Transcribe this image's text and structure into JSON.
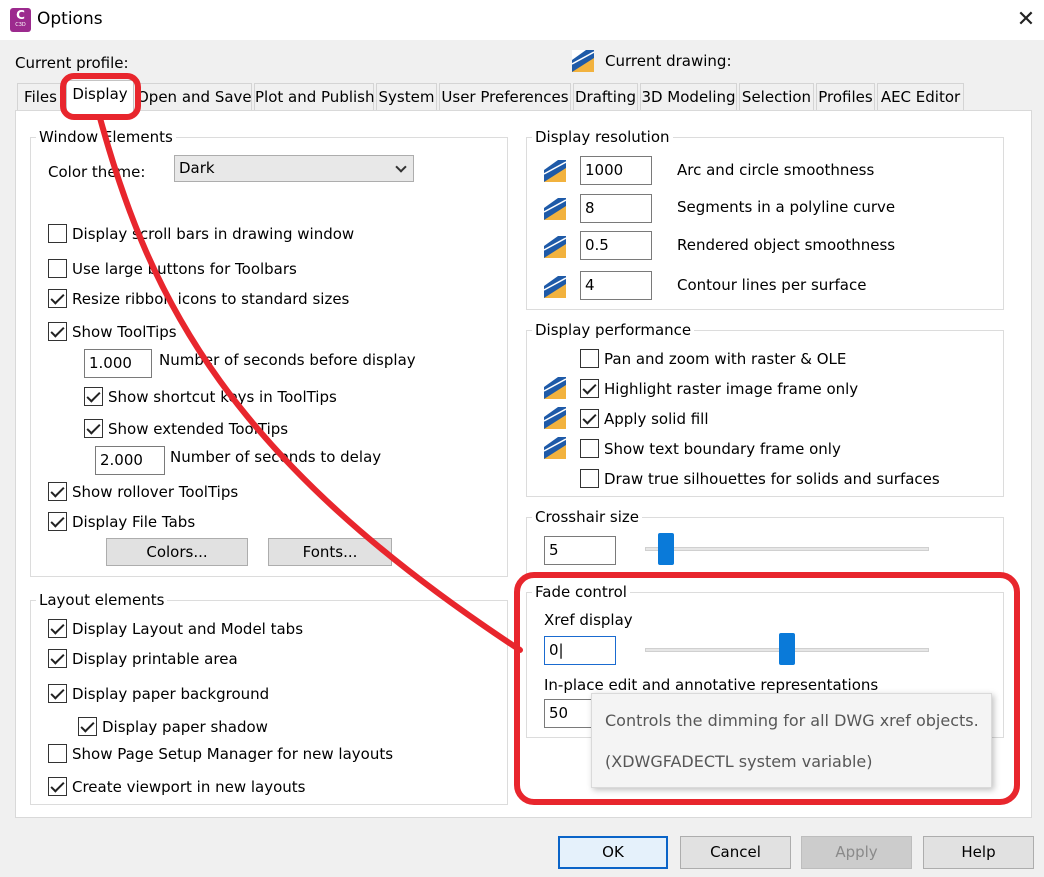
{
  "window": {
    "title": "Options",
    "app_icon_letter": "C",
    "app_icon_sub": "C3D"
  },
  "header": {
    "current_profile_label": "Current profile:",
    "current_drawing_label": "Current drawing:"
  },
  "tabs": [
    {
      "label": "Files"
    },
    {
      "label": "Display",
      "active": true
    },
    {
      "label": "Open and Save"
    },
    {
      "label": "Plot and Publish"
    },
    {
      "label": "System"
    },
    {
      "label": "User Preferences"
    },
    {
      "label": "Drafting"
    },
    {
      "label": "3D Modeling"
    },
    {
      "label": "Selection"
    },
    {
      "label": "Profiles"
    },
    {
      "label": "AEC Editor"
    }
  ],
  "window_elements": {
    "title": "Window Elements",
    "color_theme_label": "Color theme:",
    "color_theme_value": "Dark",
    "scroll_bars": {
      "label": "Display scroll bars in drawing window",
      "checked": false
    },
    "large_buttons": {
      "label": "Use large buttons for Toolbars",
      "checked": false
    },
    "resize_ribbon": {
      "label": "Resize ribbon icons to standard sizes",
      "checked": true
    },
    "show_tooltips": {
      "label": "Show ToolTips",
      "checked": true
    },
    "seconds_before": {
      "value": "1.000",
      "label": "Number of seconds before display"
    },
    "shortcut_keys": {
      "label": "Show shortcut keys in ToolTips",
      "checked": true
    },
    "extended_tooltips": {
      "label": "Show extended ToolTips",
      "checked": true
    },
    "seconds_delay": {
      "value": "2.000",
      "label": "Number of seconds to delay"
    },
    "rollover_tooltips": {
      "label": "Show rollover ToolTips",
      "checked": true
    },
    "file_tabs": {
      "label": "Display File Tabs",
      "checked": true
    },
    "colors_button": "Colors...",
    "fonts_button": "Fonts..."
  },
  "layout_elements": {
    "title": "Layout elements",
    "layout_model_tabs": {
      "label": "Display Layout and Model tabs",
      "checked": true
    },
    "printable_area": {
      "label": "Display printable area",
      "checked": true
    },
    "paper_background": {
      "label": "Display paper background",
      "checked": true
    },
    "paper_shadow": {
      "label": "Display paper shadow",
      "checked": true
    },
    "page_setup": {
      "label": "Show Page Setup Manager for new layouts",
      "checked": false
    },
    "create_viewport": {
      "label": "Create viewport in new layouts",
      "checked": true
    }
  },
  "display_resolution": {
    "title": "Display resolution",
    "arc_smoothness": {
      "value": "1000",
      "label": "Arc and circle smoothness"
    },
    "polyline_segments": {
      "value": "8",
      "label": "Segments in a polyline curve"
    },
    "rendered_smoothness": {
      "value": "0.5",
      "label": "Rendered object smoothness"
    },
    "contour_lines": {
      "value": "4",
      "label": "Contour lines per surface"
    }
  },
  "display_performance": {
    "title": "Display performance",
    "pan_zoom": {
      "label": "Pan and zoom with raster & OLE",
      "checked": false
    },
    "highlight_raster": {
      "label": "Highlight raster image frame only",
      "checked": true
    },
    "solid_fill": {
      "label": "Apply solid fill",
      "checked": true
    },
    "text_boundary": {
      "label": "Show text boundary frame only",
      "checked": false
    },
    "silhouettes": {
      "label": "Draw true silhouettes for solids and surfaces",
      "checked": false
    }
  },
  "crosshair": {
    "title": "Crosshair size",
    "value": "5",
    "level_percent": 5
  },
  "fade_control": {
    "title": "Fade control",
    "xref_label": "Xref display",
    "xref_value": "0",
    "xref_level_percent": 50,
    "inplace_label": "In-place edit and annotative representations",
    "inplace_value": "50"
  },
  "tooltip": {
    "line1": "Controls the dimming for all DWG xref objects.",
    "line2": "(XDWGFADECTL system variable)"
  },
  "footer": {
    "ok": "OK",
    "cancel": "Cancel",
    "apply": "Apply",
    "help": "Help"
  },
  "colors": {
    "annotation_red": "#e8262d",
    "slider_blue": "#0a7ad9",
    "focus_blue": "#1a6bd0",
    "app_purple": "#9c2a8e"
  }
}
